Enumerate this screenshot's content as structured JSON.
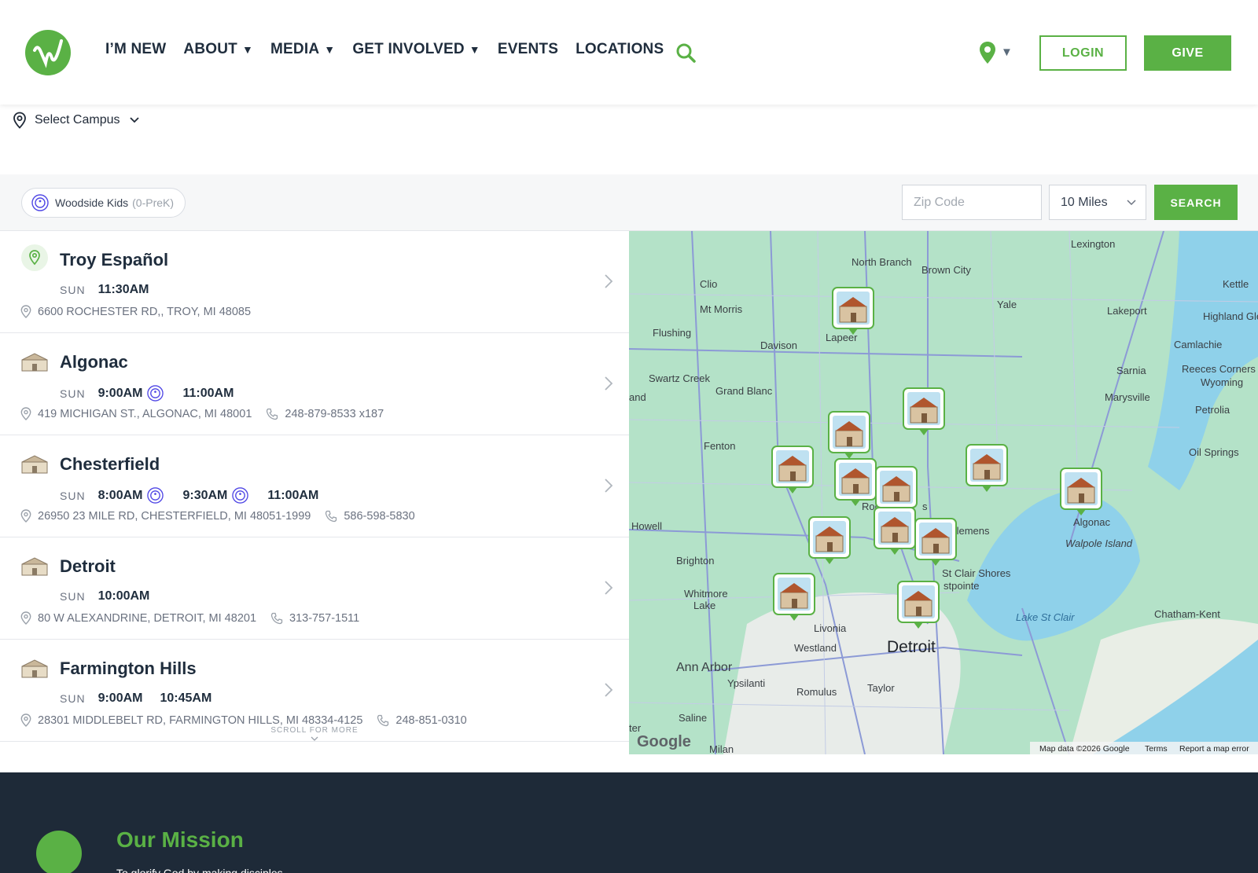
{
  "header": {
    "nav": [
      {
        "label": "I’M NEW",
        "caret": ""
      },
      {
        "label": "ABOUT",
        "caret": "▼"
      },
      {
        "label": "MEDIA",
        "caret": "▼"
      },
      {
        "label": "GET INVOLVED",
        "caret": "▼"
      },
      {
        "label": "EVENTS",
        "caret": ""
      },
      {
        "label": "LOCATIONS",
        "caret": ""
      }
    ],
    "login": "LOGIN",
    "give": "GIVE",
    "location_caret": "▼"
  },
  "campus_select": {
    "label": "Select Campus"
  },
  "filters": {
    "chip_label": "Woodside Kids",
    "chip_sub": "(0-PreK)",
    "zip_placeholder": "Zip Code",
    "miles": "10 Miles",
    "search": "SEARCH"
  },
  "locations": [
    {
      "name": "Troy Español",
      "day": "SUN",
      "times": [
        {
          "t": "11:30AM",
          "kids": false
        }
      ],
      "address": "6600 ROCHESTER RD,, TROY, MI 48085",
      "phone": ""
    },
    {
      "name": "Algonac",
      "day": "SUN",
      "times": [
        {
          "t": "9:00AM",
          "kids": true
        },
        {
          "t": "11:00AM",
          "kids": false
        }
      ],
      "address": "419 MICHIGAN ST., ALGONAC, MI 48001",
      "phone": "248-879-8533 x187"
    },
    {
      "name": "Chesterfield",
      "day": "SUN",
      "times": [
        {
          "t": "8:00AM",
          "kids": true
        },
        {
          "t": "9:30AM",
          "kids": true
        },
        {
          "t": "11:00AM",
          "kids": false
        }
      ],
      "address": "26950 23 MILE RD, CHESTERFIELD, MI 48051-1999",
      "phone": "586-598-5830"
    },
    {
      "name": "Detroit",
      "day": "SUN",
      "times": [
        {
          "t": "10:00AM",
          "kids": false
        }
      ],
      "address": "80 W ALEXANDRINE, DETROIT, MI 48201",
      "phone": "313-757-1511"
    },
    {
      "name": "Farmington Hills",
      "day": "SUN",
      "times": [
        {
          "t": "9:00AM",
          "kids": false
        },
        {
          "t": "10:45AM",
          "kids": false
        }
      ],
      "address": "28301 MIDDLEBELT RD, FARMINGTON HILLS, MI 48334-4125",
      "phone": "248-851-0310"
    }
  ],
  "scroll_more": "SCROLL FOR MORE",
  "map": {
    "labels": {
      "lexington": "Lexington",
      "north_branch": "North Branch",
      "brown_city": "Brown City",
      "clio": "Clio",
      "mt_morris": "Mt Morris",
      "flushing": "Flushing",
      "davison": "Davison",
      "lapeer": "Lapeer",
      "yale": "Yale",
      "lakeport": "Lakeport",
      "kettle": "Kettle",
      "highland": "Highland Glen",
      "camlachie": "Camlachie",
      "sarnia": "Sarnia",
      "reeces": "Reeces Corners",
      "wyoming": "Wyoming",
      "swartz": "Swartz Creek",
      "grand_blanc": "Grand Blanc",
      "marysville": "Marysville",
      "petrolia": "Petrolia",
      "and": "and",
      "fenton": "Fenton",
      "oil_springs": "Oil Springs",
      "howell": "Howell",
      "mt_clemens": "t Clemens",
      "algonac": "Algonac",
      "walpole": "Walpole Island",
      "brighton": "Brighton",
      "st_clair_shores": "St Clair Shores",
      "stpointe": "stpointe",
      "whitmore": "Whitmore",
      "lake": "Lake",
      "lake_st_clair": "Lake St Clair",
      "chatham": "Chatham-Kent",
      "livonia": "Livonia",
      "westland": "Westland",
      "detroit": "Detroit",
      "ann_arbor": "Ann Arbor",
      "ypsilanti": "Ypsilanti",
      "romulus": "Romulus",
      "taylor": "Taylor",
      "saline": "Saline",
      "ter": "ter",
      "milan": "Milan",
      "roch": "Roch",
      "s": "s"
    },
    "google": "Google",
    "attribution": "Map data ©2026 Google",
    "terms": "Terms",
    "report": "Report a map error"
  },
  "footer": {
    "title": "Our Mission",
    "text": "To glorify God by making disciples"
  },
  "colors": {
    "brand_green": "#5ab145",
    "footer_bg": "#1e2a38",
    "kids_icon": "#4f46e5"
  }
}
